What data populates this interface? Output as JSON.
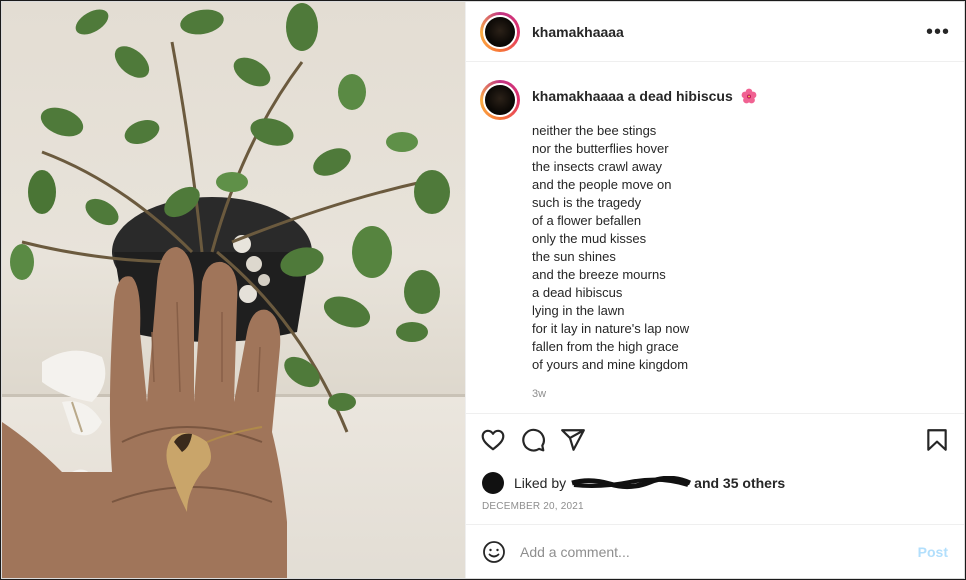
{
  "post": {
    "username": "khamakhaaaa",
    "more_icon": "more-horizontal-icon",
    "photo_description_icon": "post-photo",
    "caption": {
      "username": "khamakhaaaa",
      "title": "a dead hibiscus",
      "emoji": "hibiscus-emoji",
      "lines": [
        "neither the bee stings",
        "nor the butterflies hover",
        "the insects crawl away",
        "and the people move on",
        "such is the tragedy",
        "of a flower befallen",
        "only the mud kisses",
        "the sun shines",
        "and the breeze mourns",
        "a dead hibiscus",
        "lying in the lawn",
        "for it lay in nature's lap now",
        "fallen from the high grace",
        "of yours and mine kingdom"
      ],
      "time_ago": "3w"
    },
    "actions": {
      "like_icon": "heart-icon",
      "comment_icon": "comment-icon",
      "share_icon": "share-icon",
      "save_icon": "bookmark-icon"
    },
    "likes": {
      "prefix": "Liked by",
      "suffix": "and 35 others"
    },
    "date": "DECEMBER 20, 2021",
    "comment_box": {
      "placeholder": "Add a comment...",
      "post_label": "Post"
    },
    "colors": {
      "post_button_disabled": "#b2dffc",
      "secondary_text": "#8e8e8e",
      "primary_text": "#262626",
      "border": "#efefef"
    }
  }
}
